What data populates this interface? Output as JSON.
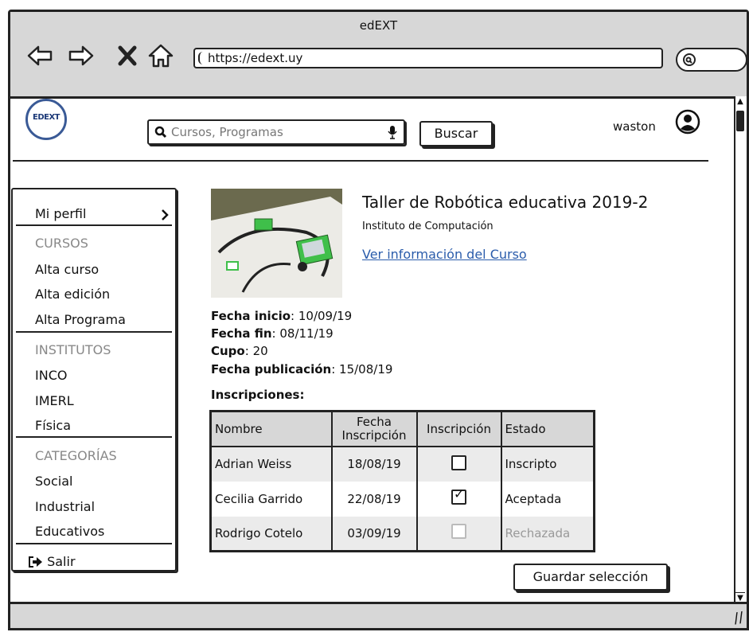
{
  "window": {
    "title": "edEXT",
    "url": "https://edext.uy"
  },
  "icons": {
    "back": "back-arrow-icon",
    "forward": "forward-arrow-icon",
    "stop": "close-icon",
    "home": "home-icon",
    "search": "search-icon",
    "mic": "microphone-icon",
    "user": "user-avatar-icon",
    "logout": "logout-icon"
  },
  "header": {
    "logo_text": "EDEXT",
    "search_placeholder": "Cursos, Programas",
    "search_button": "Buscar",
    "username": "waston"
  },
  "sidebar": {
    "profile": "Mi perfil",
    "cursos_header": "CURSOS",
    "cursos": [
      "Alta curso",
      "Alta edición",
      "Alta Programa"
    ],
    "institutos_header": "INSTITUTOS",
    "institutos": [
      "INCO",
      "IMERL",
      "Física"
    ],
    "categorias_header": "CATEGORÍAS",
    "categorias": [
      "Social",
      "Industrial",
      "Educativos"
    ],
    "logout": "Salir"
  },
  "course": {
    "title": "Taller de Robótica educativa 2019-2",
    "institute": "Instituto de Computación",
    "link": "Ver información del Curso",
    "fields": [
      {
        "label": "Fecha inicio",
        "value": "10/09/19"
      },
      {
        "label": "Fecha fin",
        "value": "08/11/19"
      },
      {
        "label": "Cupo",
        "value": "20"
      },
      {
        "label": "Fecha publicación",
        "value": "15/08/19"
      }
    ]
  },
  "inscriptions": {
    "heading": "Inscripciones:",
    "columns": {
      "name": "Nombre",
      "date_line1": "Fecha",
      "date_line2": "Inscripción",
      "check": "Inscripción",
      "state": "Estado"
    },
    "rows": [
      {
        "name": "Adrian Weiss",
        "date": "18/08/19",
        "checked": false,
        "disabled": false,
        "state": "Inscripto"
      },
      {
        "name": "Cecilia Garrido",
        "date": "22/08/19",
        "checked": true,
        "disabled": false,
        "state": "Aceptada"
      },
      {
        "name": "Rodrigo Cotelo",
        "date": "03/09/19",
        "checked": false,
        "disabled": true,
        "state": "Rechazada"
      }
    ]
  },
  "save_button": "Guardar selección"
}
